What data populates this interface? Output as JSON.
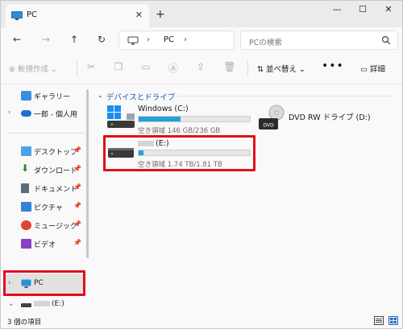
{
  "window": {
    "tab_title": "PC"
  },
  "nav": {
    "address_segment": "PC",
    "search_placeholder": "PCの検索"
  },
  "toolbar": {
    "new_label": "⊕ 新規作成 ⌄",
    "sort_label": "並べ替え ⌄",
    "details_label": "詳細"
  },
  "sidebar": {
    "items": [
      {
        "label": "ギャラリー"
      },
      {
        "label": "一郎 - 個人用"
      },
      {
        "label": "デスクトップ"
      },
      {
        "label": "ダウンロード"
      },
      {
        "label": "ドキュメント"
      },
      {
        "label": "ピクチャ"
      },
      {
        "label": "ミュージック"
      },
      {
        "label": "ビデオ"
      },
      {
        "label": "PC"
      },
      {
        "label": "(E:)"
      }
    ]
  },
  "main": {
    "group_title": "デバイスとドライブ",
    "drives": [
      {
        "name": "Windows (C:)",
        "space": "空き領域 146 GB/236 GB",
        "used_fraction": 0.38
      },
      {
        "name": "DVD RW ドライブ (D:)"
      },
      {
        "name": "(E:)",
        "space": "空き領域 1.74 TB/1.81 TB",
        "used_fraction": 0.04
      }
    ]
  },
  "status": {
    "count_text": "3 個の項目"
  },
  "colors": {
    "accent": "#26a0da",
    "highlight": "#e0101a",
    "group_title": "#1d5aa8"
  }
}
